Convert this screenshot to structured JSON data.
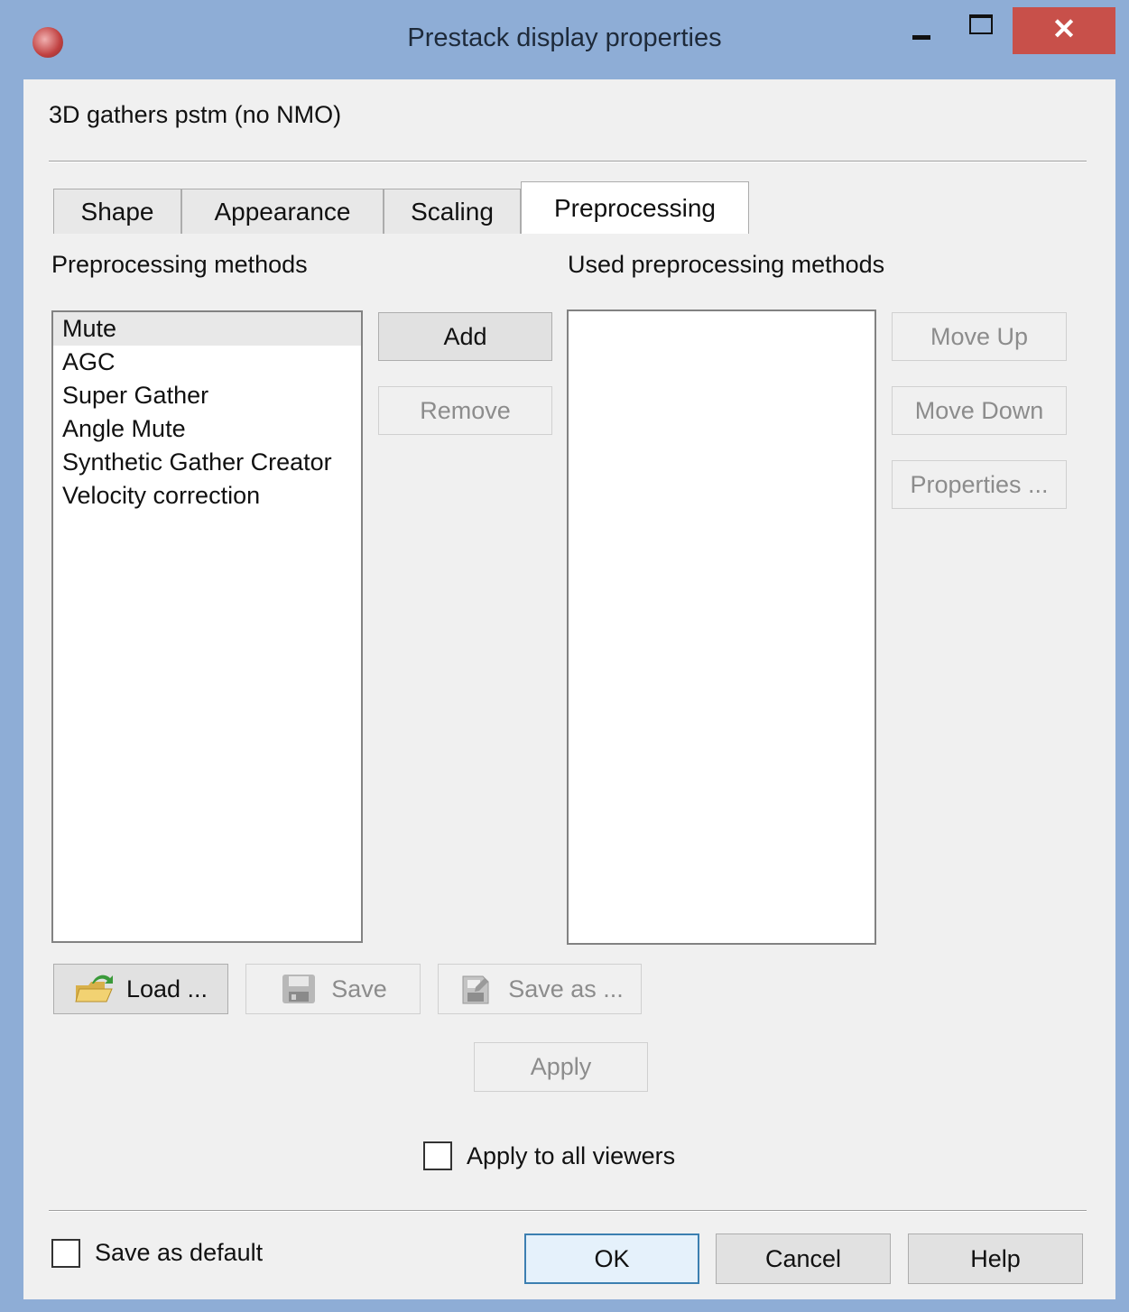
{
  "window": {
    "title": "Prestack display properties",
    "close_symbol": "✕"
  },
  "header": {
    "object_name": "3D gathers pstm (no NMO)"
  },
  "tabs": [
    {
      "label": "Shape",
      "active": false
    },
    {
      "label": "Appearance",
      "active": false
    },
    {
      "label": "Scaling",
      "active": false
    },
    {
      "label": "Preprocessing",
      "active": true
    }
  ],
  "methods": {
    "label": "Preprocessing methods",
    "items": [
      "Mute",
      "AGC",
      "Super Gather",
      "Angle Mute",
      "Synthetic Gather Creator",
      "Velocity correction"
    ],
    "selected": "Mute"
  },
  "used_methods": {
    "label": "Used preprocessing methods",
    "items": []
  },
  "buttons": {
    "add": "Add",
    "remove": "Remove",
    "move_up": "Move Up",
    "move_down": "Move Down",
    "properties": "Properties ...",
    "load": "Load ...",
    "save": "Save",
    "save_as": "Save as ...",
    "apply": "Apply",
    "ok": "OK",
    "cancel": "Cancel",
    "help": "Help"
  },
  "options": {
    "apply_all_viewers": {
      "label": "Apply to all viewers",
      "checked": false
    },
    "save_as_default": {
      "label": "Save as default",
      "checked": false
    }
  },
  "icons": {
    "load": "folder-open-icon",
    "save": "floppy-disk-icon",
    "save_as": "save-as-icon",
    "app": "app-icon"
  }
}
